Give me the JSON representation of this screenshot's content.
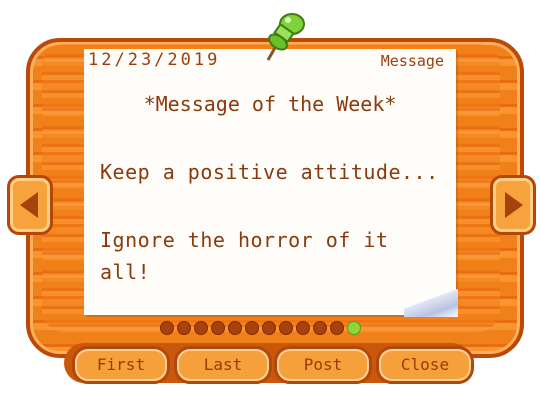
{
  "header": {
    "date": "12/23/2019",
    "label": "Message"
  },
  "message": {
    "title": "*Message of the Week*",
    "lines": [
      "Keep a positive attitude...",
      "Ignore the horror of it",
      "all!"
    ]
  },
  "pagination": {
    "total": 12,
    "active_index": 11
  },
  "buttons": {
    "first": "First",
    "last": "Last",
    "post": "Post",
    "close": "Close"
  },
  "colors": {
    "frame": "#f0801a",
    "frame_border": "#b94a08",
    "text": "#8a3a0c",
    "active_dot": "#8fd63b",
    "pin": "#7ed23a"
  },
  "icons": {
    "pin": "pushpin-icon",
    "left": "arrow-left-icon",
    "right": "arrow-right-icon"
  }
}
